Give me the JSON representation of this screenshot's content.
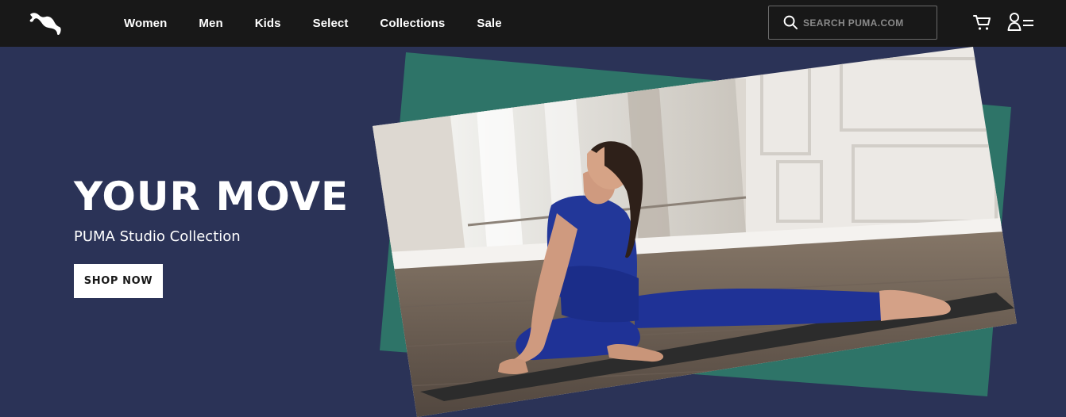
{
  "header": {
    "logo_icon": "puma-cat-logo-icon",
    "nav_items": [
      "Women",
      "Men",
      "Kids",
      "Select",
      "Collections",
      "Sale"
    ],
    "search": {
      "placeholder": "SEARCH PUMA.COM",
      "value": "",
      "icon": "search-icon"
    },
    "cart_icon": "cart-icon",
    "account_icon": "account-menu-icon"
  },
  "hero": {
    "title": "YOUR MOVE",
    "subtitle": "PUMA Studio Collection",
    "cta_label": "SHOP NOW",
    "image_description": "woman in blue activewear doing a yoga stretch on a mat in a studio",
    "colors": {
      "background": "#2b3357",
      "accent_panel": "#2e7468",
      "cta_background": "#ffffff",
      "cta_text": "#181818"
    }
  }
}
